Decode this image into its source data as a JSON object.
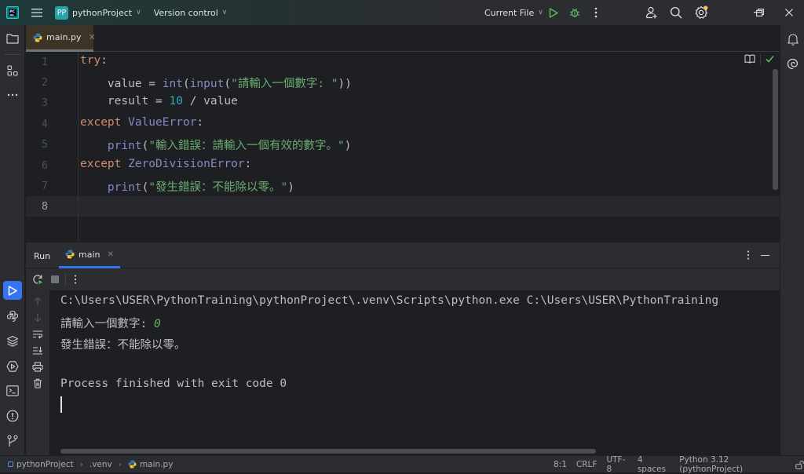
{
  "titlebar": {
    "project_badge": "PP",
    "project_name": "pythonProject",
    "vcs_label": "Version control",
    "run_config": "Current File",
    "accent_color": "#5fb865",
    "settings_badge_color": "#f2c55c"
  },
  "editor": {
    "tab_label": "main.py",
    "lines": [
      {
        "num": "1"
      },
      {
        "num": "2"
      },
      {
        "num": "3"
      },
      {
        "num": "4"
      },
      {
        "num": "5"
      },
      {
        "num": "6"
      },
      {
        "num": "7"
      },
      {
        "num": "8"
      }
    ],
    "code": {
      "l1_kw": "try",
      "l1_colon": ":",
      "l2_pre": "    value = ",
      "l2_int": "int",
      "l2_paren": "(",
      "l2_input": "input",
      "l2_paren2": "(",
      "l2_str": "\"請輸入一個數字: \"",
      "l2_close": "))",
      "l3_pre": "    result = ",
      "l3_num": "10",
      "l3_post": " / value",
      "l4_kw": "except",
      "l4_cls": " ValueError",
      "l4_colon": ":",
      "l5_pre": "    ",
      "l5_fn": "print",
      "l5_paren": "(",
      "l5_str": "\"輸入錯誤：請輸入一個有效的數字。\"",
      "l5_close": ")",
      "l6_kw": "except",
      "l6_cls": " ZeroDivisionError",
      "l6_colon": ":",
      "l7_pre": "    ",
      "l7_fn": "print",
      "l7_paren": "(",
      "l7_str": "\"發生錯誤：不能除以零。\"",
      "l7_close": ")"
    }
  },
  "run_panel": {
    "title": "Run",
    "tab_label": "main",
    "console": {
      "command": "C:\\Users\\USER\\PythonTraining\\pythonProject\\.venv\\Scripts\\python.exe C:\\Users\\USER\\PythonTraining",
      "prompt": "請輸入一個數字: ",
      "user_input": "0",
      "error_msg": "發生錯誤：不能除以零。",
      "finish_msg": "Process finished with exit code 0"
    }
  },
  "statusbar": {
    "breadcrumb": [
      "pythonProject",
      ".venv",
      "main.py"
    ],
    "position": "8:1",
    "line_ending": "CRLF",
    "encoding": "UTF-8",
    "indent": "4 spaces",
    "interpreter": "Python 3.12 (pythonProject)"
  }
}
